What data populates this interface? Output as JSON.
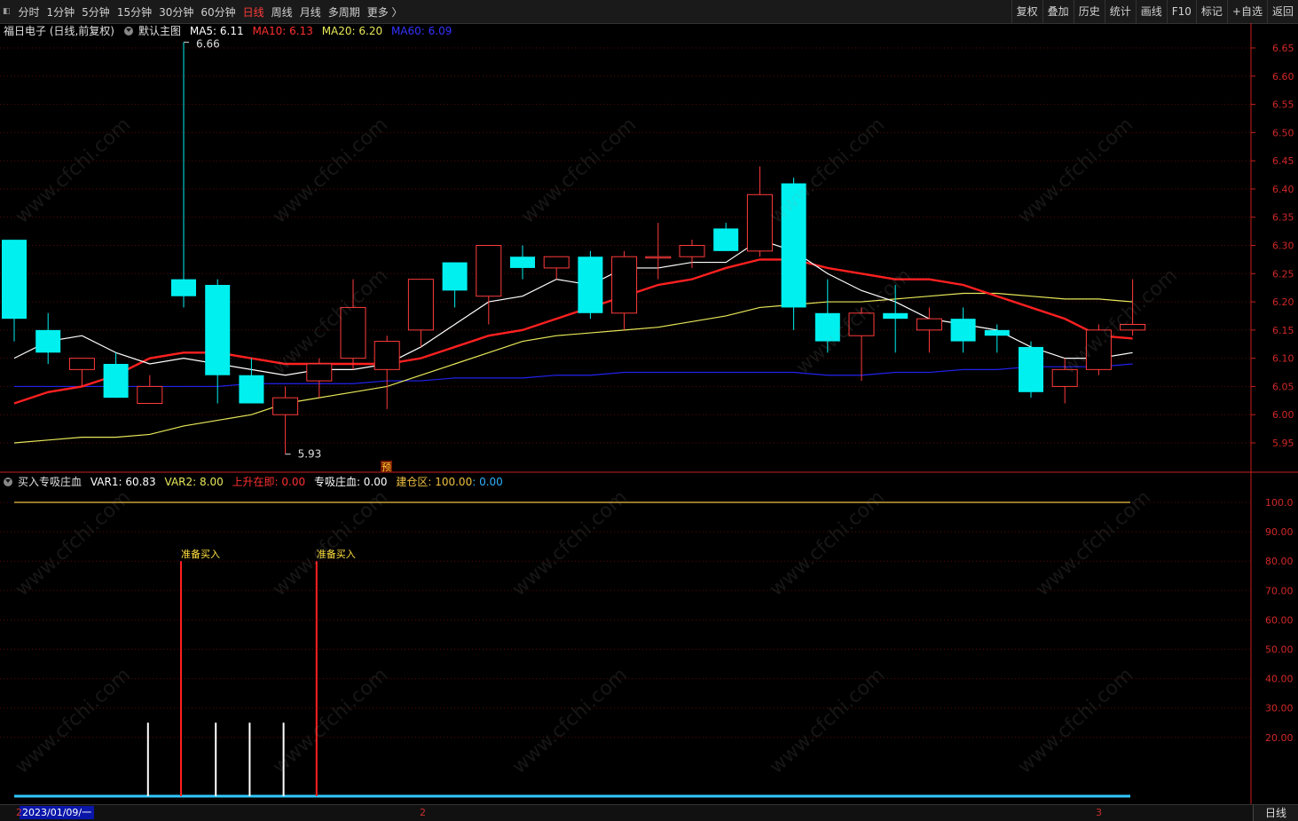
{
  "toolbar": {
    "periods": [
      "分时",
      "1分钟",
      "5分钟",
      "15分钟",
      "30分钟",
      "60分钟",
      "日线",
      "周线",
      "月线",
      "多周期",
      "更多 〉"
    ],
    "active_period": "日线",
    "right_buttons": [
      "复权",
      "叠加",
      "历史",
      "统计",
      "画线",
      "F10",
      "标记",
      "+自选",
      "返回"
    ]
  },
  "main_info": {
    "stock": "福日电子 (日线,前复权)",
    "template": "默认主图",
    "ma5": "MA5: 6.11",
    "ma10": "MA10: 6.13",
    "ma20": "MA20: 6.20",
    "ma60": "MA60: 6.09"
  },
  "sub_info": {
    "name": "买入专吸庄血",
    "var1": "VAR1: 60.83",
    "var2": "VAR2: 8.00",
    "rise": "上升在即: 0.00",
    "absorb": "专吸庄血: 0.00",
    "build": "建仓区: 100.00",
    "build_extra": ": 0.00"
  },
  "colors": {
    "up": "#ff3b3b",
    "down": "#00f0f0",
    "ma5": "#ffffff",
    "ma10": "#ff2020",
    "ma20": "#e8e85a",
    "ma60": "#2222ee",
    "axis": "#c81e1e",
    "grid": "#5a0a0a"
  },
  "status": {
    "date": "2023/01/09/一",
    "month_marks": [
      "2",
      "2",
      "3"
    ],
    "day_button": "日线"
  },
  "watermark": "www.cfchi.com",
  "chart_data": [
    {
      "type": "candlestick",
      "ylim": [
        5.9,
        6.67
      ],
      "y_ticks": [
        6.65,
        6.6,
        6.55,
        6.5,
        6.45,
        6.4,
        6.35,
        6.3,
        6.25,
        6.2,
        6.15,
        6.1,
        6.05,
        6.0,
        5.95
      ],
      "high_label": "6.66",
      "low_label": "5.93",
      "pre_marker": "预",
      "candles": [
        {
          "o": 6.31,
          "h": 6.31,
          "l": 6.13,
          "c": 6.17
        },
        {
          "o": 6.15,
          "h": 6.18,
          "l": 6.09,
          "c": 6.11
        },
        {
          "o": 6.08,
          "h": 6.1,
          "l": 6.05,
          "c": 6.1
        },
        {
          "o": 6.09,
          "h": 6.11,
          "l": 6.03,
          "c": 6.03
        },
        {
          "o": 6.02,
          "h": 6.07,
          "l": 6.02,
          "c": 6.05
        },
        {
          "o": 6.24,
          "h": 6.66,
          "l": 6.19,
          "c": 6.21
        },
        {
          "o": 6.23,
          "h": 6.24,
          "l": 6.02,
          "c": 6.07
        },
        {
          "o": 6.07,
          "h": 6.1,
          "l": 6.02,
          "c": 6.02
        },
        {
          "o": 6.0,
          "h": 6.05,
          "l": 5.93,
          "c": 6.03
        },
        {
          "o": 6.06,
          "h": 6.1,
          "l": 6.03,
          "c": 6.09
        },
        {
          "o": 6.1,
          "h": 6.24,
          "l": 6.08,
          "c": 6.19
        },
        {
          "o": 6.08,
          "h": 6.14,
          "l": 6.01,
          "c": 6.13
        },
        {
          "o": 6.15,
          "h": 6.24,
          "l": 6.12,
          "c": 6.24
        },
        {
          "o": 6.27,
          "h": 6.27,
          "l": 6.19,
          "c": 6.22
        },
        {
          "o": 6.21,
          "h": 6.3,
          "l": 6.16,
          "c": 6.3
        },
        {
          "o": 6.28,
          "h": 6.3,
          "l": 6.24,
          "c": 6.26
        },
        {
          "o": 6.26,
          "h": 6.28,
          "l": 6.24,
          "c": 6.28
        },
        {
          "o": 6.28,
          "h": 6.29,
          "l": 6.17,
          "c": 6.18
        },
        {
          "o": 6.18,
          "h": 6.29,
          "l": 6.15,
          "c": 6.28
        },
        {
          "o": 6.28,
          "h": 6.34,
          "l": 6.24,
          "c": 6.28
        },
        {
          "o": 6.28,
          "h": 6.31,
          "l": 6.26,
          "c": 6.3
        },
        {
          "o": 6.33,
          "h": 6.34,
          "l": 6.29,
          "c": 6.29
        },
        {
          "o": 6.29,
          "h": 6.44,
          "l": 6.28,
          "c": 6.39
        },
        {
          "o": 6.41,
          "h": 6.42,
          "l": 6.15,
          "c": 6.19
        },
        {
          "o": 6.18,
          "h": 6.24,
          "l": 6.11,
          "c": 6.13
        },
        {
          "o": 6.14,
          "h": 6.19,
          "l": 6.06,
          "c": 6.18
        },
        {
          "o": 6.18,
          "h": 6.23,
          "l": 6.11,
          "c": 6.17
        },
        {
          "o": 6.15,
          "h": 6.19,
          "l": 6.11,
          "c": 6.17
        },
        {
          "o": 6.17,
          "h": 6.19,
          "l": 6.11,
          "c": 6.13
        },
        {
          "o": 6.15,
          "h": 6.16,
          "l": 6.11,
          "c": 6.14
        },
        {
          "o": 6.12,
          "h": 6.13,
          "l": 6.03,
          "c": 6.04
        },
        {
          "o": 6.05,
          "h": 6.1,
          "l": 6.02,
          "c": 6.08
        },
        {
          "o": 6.08,
          "h": 6.16,
          "l": 6.07,
          "c": 6.15
        },
        {
          "o": 6.15,
          "h": 6.24,
          "l": 6.14,
          "c": 6.16
        }
      ],
      "ma5": [
        6.1,
        6.13,
        6.14,
        6.11,
        6.09,
        6.1,
        6.09,
        6.08,
        6.07,
        6.08,
        6.08,
        6.09,
        6.12,
        6.16,
        6.2,
        6.21,
        6.24,
        6.23,
        6.26,
        6.26,
        6.27,
        6.27,
        6.31,
        6.29,
        6.25,
        6.22,
        6.2,
        6.17,
        6.16,
        6.15,
        6.12,
        6.1,
        6.1,
        6.11
      ],
      "ma10": [
        6.02,
        6.04,
        6.05,
        6.07,
        6.1,
        6.11,
        6.11,
        6.1,
        6.09,
        6.09,
        6.09,
        6.09,
        6.1,
        6.12,
        6.14,
        6.15,
        6.17,
        6.19,
        6.21,
        6.23,
        6.24,
        6.26,
        6.275,
        6.275,
        6.26,
        6.25,
        6.24,
        6.24,
        6.23,
        6.21,
        6.19,
        6.17,
        6.14,
        6.135
      ],
      "ma20": [
        5.95,
        5.955,
        5.96,
        5.96,
        5.965,
        5.98,
        5.99,
        6.0,
        6.02,
        6.03,
        6.04,
        6.05,
        6.07,
        6.09,
        6.11,
        6.13,
        6.14,
        6.145,
        6.15,
        6.155,
        6.165,
        6.175,
        6.19,
        6.195,
        6.2,
        6.2,
        6.205,
        6.21,
        6.215,
        6.215,
        6.21,
        6.205,
        6.205,
        6.2
      ],
      "ma60": [
        6.05,
        6.05,
        6.05,
        6.05,
        6.05,
        6.05,
        6.05,
        6.055,
        6.055,
        6.055,
        6.055,
        6.06,
        6.06,
        6.065,
        6.065,
        6.065,
        6.07,
        6.07,
        6.075,
        6.075,
        6.075,
        6.075,
        6.075,
        6.075,
        6.07,
        6.07,
        6.075,
        6.075,
        6.08,
        6.08,
        6.085,
        6.085,
        6.085,
        6.09
      ]
    },
    {
      "type": "bar",
      "ylim": [
        0,
        105
      ],
      "y_ticks": [
        100,
        90,
        80,
        70,
        60,
        50,
        40,
        30,
        20
      ],
      "tick_labels": [
        "100.0",
        "90.00",
        "80.00",
        "70.00",
        "60.00",
        "50.00",
        "40.00",
        "30.00",
        "20.00"
      ],
      "build_level": 100,
      "baseline": 0,
      "white_bars": [
        {
          "i": 4,
          "v": 25
        },
        {
          "i": 6,
          "v": 25
        },
        {
          "i": 7,
          "v": 25
        },
        {
          "i": 8,
          "v": 25
        }
      ],
      "buy_bars": [
        {
          "i": 5,
          "v": 80,
          "label": "准备买入"
        },
        {
          "i": 9,
          "v": 80,
          "label": "准备买入"
        }
      ]
    }
  ]
}
